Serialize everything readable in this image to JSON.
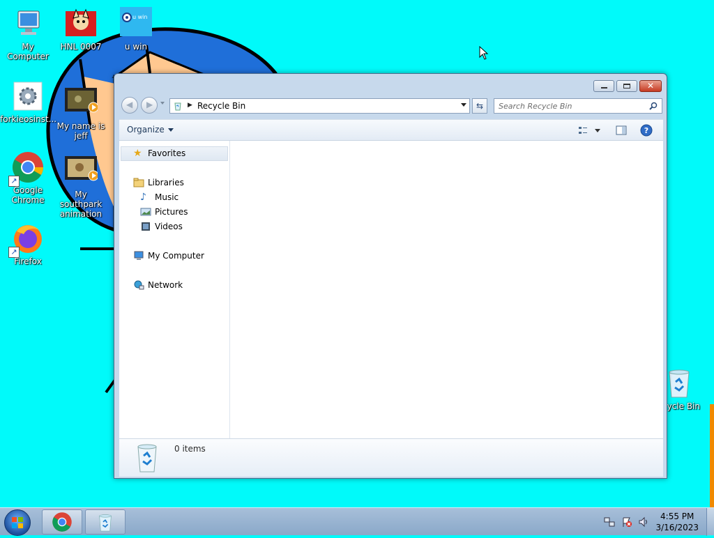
{
  "desktop": {
    "background_color": "#00fafa",
    "icons": [
      {
        "label": "My Computer",
        "icon": "computer-icon"
      },
      {
        "label": "HNL 0007",
        "icon": "image-thumbnail-icon"
      },
      {
        "label": "u win",
        "icon": "u-win-icon",
        "image_text": "u win"
      },
      {
        "label": "forkieosinst...",
        "icon": "settings-gear-icon"
      },
      {
        "label": "My name is jeff",
        "icon": "video-file-icon"
      },
      {
        "label": "Google Chrome",
        "icon": "chrome-icon"
      },
      {
        "label": "My southpark animation",
        "icon": "video-file-icon"
      },
      {
        "label": "Firefox",
        "icon": "firefox-icon"
      },
      {
        "label": "cycle Bin",
        "icon": "recycle-bin-icon"
      }
    ]
  },
  "window": {
    "title": "Recycle Bin",
    "address": {
      "location": "Recycle Bin"
    },
    "search": {
      "placeholder": "Search Recycle Bin"
    },
    "toolbar": {
      "organize_label": "Organize"
    },
    "nav": {
      "favorites": "Favorites",
      "libraries": "Libraries",
      "music": "Music",
      "pictures": "Pictures",
      "videos": "Videos",
      "computer": "My Computer",
      "network": "Network"
    },
    "details": {
      "item_count": "0 items"
    }
  },
  "taskbar": {
    "time": "4:55 PM",
    "date": "3/16/2023",
    "pinned": [
      "chrome-icon",
      "recycle-bin-icon"
    ]
  },
  "colors": {
    "accent": "#1c4f9c",
    "close_button": "#c63a22",
    "window_frame": "#c7d9ec"
  }
}
